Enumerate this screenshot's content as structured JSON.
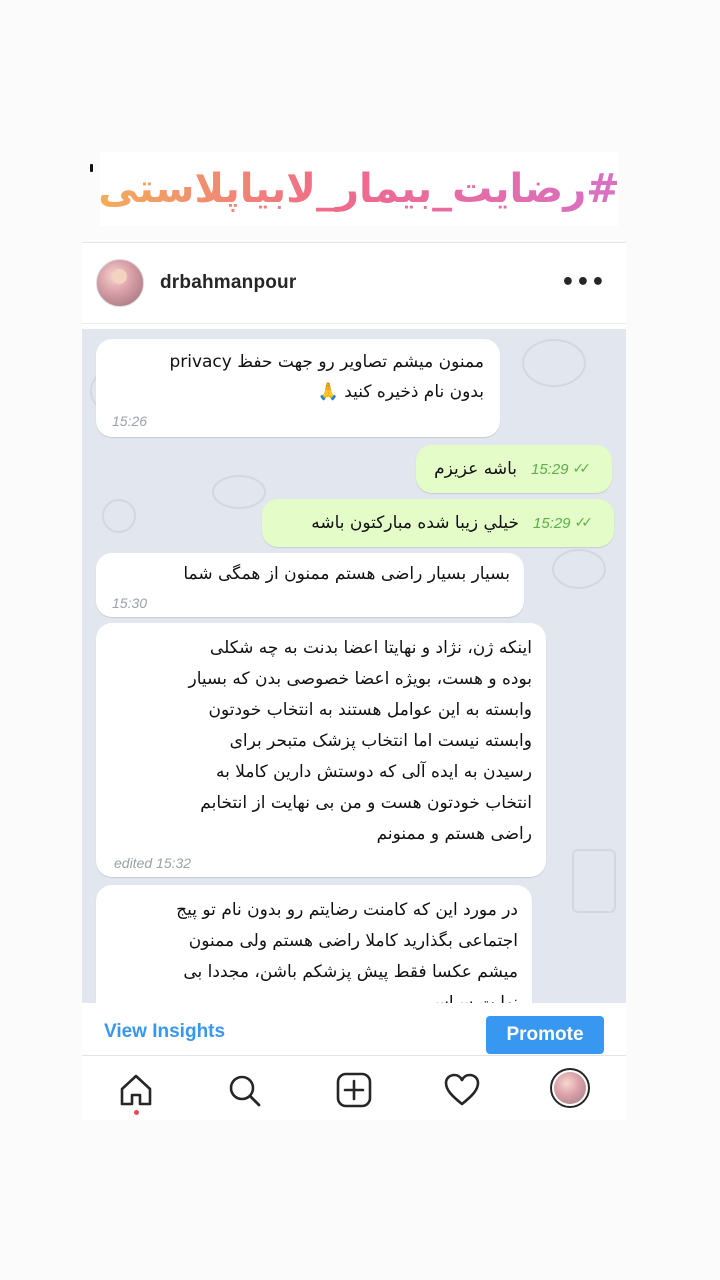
{
  "banner": {
    "hashtag": "#رضایت_بیمار_لابیاپلاستی"
  },
  "post": {
    "username": "drbahmanpour",
    "more_icon": "ellipsis-icon"
  },
  "chat": {
    "messages": [
      {
        "direction": "in",
        "text": "ممنون میشم  تصاویر رو جهت حفظ privacy\nبدون نام ذخیره کنید 🙏",
        "time": "15:26"
      },
      {
        "direction": "out",
        "text": "باشه عزیزم",
        "time": "15:29"
      },
      {
        "direction": "out",
        "text": "خيلي زيبا شده مباركتون باشه",
        "time": "15:29"
      },
      {
        "direction": "in",
        "text": "بسیار بسیار راضی هستم ممنون از همگی شما",
        "time": "15:30"
      },
      {
        "direction": "in",
        "text": "اینکه ژن، نژاد و نهایتا اعضا بدنت به چه شکلی\nبوده و هست، بویژه اعضا خصوصی بدن که بسیار\nوابسته به این عوامل هستند به انتخاب خودتون\nوابسته نیست اما انتخاب پزشک متبحر برای\nرسیدن به ایده آلی که دوستش دارین کاملا به\nانتخاب خودتون هست و من  بی نهایت از انتخابم\nراضی هستم و ممنونم",
        "time": "edited 15:32"
      },
      {
        "direction": "in",
        "text": "در مورد این که کامنت رضایتم رو بدون نام تو پیج\nاجتماعی بگذارید کاملا راضی هستم ولی ممنون\nمیشم عکسا فقط پیش پزشکم باشن،  مجددا بی\nنهایت سپاس",
        "time": ""
      }
    ],
    "check_icon": "double-check-icon"
  },
  "actions": {
    "view_insights": "View Insights",
    "promote": "Promote"
  },
  "nav": {
    "items": [
      "home-icon",
      "search-icon",
      "new-post-icon",
      "activity-heart-icon",
      "profile-avatar"
    ]
  },
  "colors": {
    "accent": "#3897f0",
    "outgoing_bubble": "#e4fcc8",
    "chat_background": "#e2e6ee",
    "notification_dot": "#ed4956"
  }
}
